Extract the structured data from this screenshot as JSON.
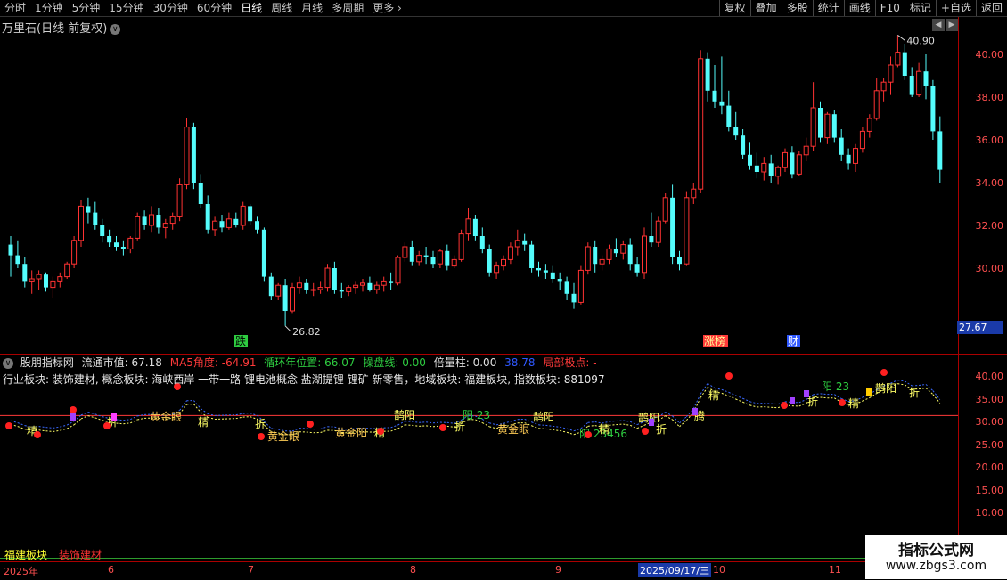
{
  "toolbar": {
    "timeframes": [
      "分时",
      "1分钟",
      "5分钟",
      "15分钟",
      "30分钟",
      "60分钟",
      "日线",
      "周线",
      "月线",
      "多周期",
      "更多"
    ],
    "active": "日线",
    "right_buttons": [
      "复权",
      "叠加",
      "多股",
      "统计",
      "画线",
      "F10",
      "标记",
      "+自选",
      "返回"
    ]
  },
  "stock": {
    "title": "万里石(日线 前复权)"
  },
  "price_axis": {
    "ticks": [
      "40.00",
      "38.00",
      "36.00",
      "34.00",
      "32.00",
      "30.00"
    ],
    "current_price": "27.67"
  },
  "annotations": {
    "high": "40.90",
    "low": "26.82",
    "marker_die": "跌",
    "marker_zhangbang": "涨榜",
    "marker_cai": "财"
  },
  "indicator": {
    "name": "股朋指标网",
    "float_mv": "流通市值: 67.18",
    "ma5_angle": "MA5角度: -64.91",
    "cycle_pos": "循环年位置: 66.07",
    "op_line": "操盘线: 0.00",
    "bei_li": "倍量柱: 0.00",
    "num": "38.78",
    "local_pt": "局部极点: -",
    "sectors": "行业板块: 装饰建材, 概念板块: 海峡西岸 一带一路 锂电池概念 盐湖提锂 锂矿 新零售，地域板块: 福建板块, 指数板块: 881097",
    "axis_ticks": [
      "40.00",
      "35.00",
      "30.00",
      "25.00",
      "20.00",
      "15.00",
      "10.00"
    ]
  },
  "signals": [
    "精",
    "折",
    "黄金眼",
    "精",
    "折",
    "黄金眼",
    "黄金阳",
    "精",
    "鹊阳",
    "阳 23",
    "折",
    "黄金眼",
    "鹊阳",
    "阳 23456",
    "精",
    "鹊阳",
    "折",
    "腾",
    "精",
    "阳 23",
    "折",
    "精",
    "鹊阳",
    "折"
  ],
  "bottom_labels": {
    "label1": "福建板块",
    "label2": "装饰建材"
  },
  "date_axis": {
    "labels": [
      "2025年",
      "6",
      "7",
      "8",
      "9",
      "10",
      "11"
    ],
    "highlight": "2025/09/17/三"
  },
  "watermark": {
    "title": "指标公式网",
    "url": "www.zbgs3.com"
  },
  "colors": {
    "up": "#ff3232",
    "down": "#54fcfc",
    "axis": "#a00000"
  },
  "candles": [
    [
      31.1,
      31.5,
      29.6,
      30.6
    ],
    [
      30.6,
      31.3,
      30.0,
      30.2
    ],
    [
      30.2,
      30.5,
      29.1,
      29.4
    ],
    [
      29.4,
      29.9,
      28.8,
      29.5
    ],
    [
      29.5,
      29.9,
      29.0,
      29.7
    ],
    [
      29.7,
      29.8,
      28.9,
      29.1
    ],
    [
      29.1,
      29.6,
      28.6,
      29.4
    ],
    [
      29.4,
      29.8,
      29.1,
      29.6
    ],
    [
      29.6,
      30.3,
      29.5,
      30.2
    ],
    [
      30.2,
      31.5,
      30.0,
      31.3
    ],
    [
      31.3,
      33.2,
      31.0,
      32.9
    ],
    [
      32.9,
      33.3,
      32.1,
      32.6
    ],
    [
      32.6,
      33.1,
      31.8,
      32.0
    ],
    [
      32.0,
      32.3,
      31.2,
      31.5
    ],
    [
      31.5,
      31.8,
      31.0,
      31.2
    ],
    [
      31.2,
      31.5,
      30.8,
      31.0
    ],
    [
      31.0,
      31.3,
      30.6,
      30.9
    ],
    [
      30.9,
      31.5,
      30.7,
      31.4
    ],
    [
      31.4,
      32.6,
      31.3,
      32.4
    ],
    [
      32.4,
      32.7,
      31.8,
      32.0
    ],
    [
      32.0,
      32.9,
      31.7,
      32.5
    ],
    [
      32.5,
      32.8,
      31.6,
      31.9
    ],
    [
      31.9,
      32.3,
      31.4,
      32.1
    ],
    [
      32.1,
      32.6,
      31.8,
      32.4
    ],
    [
      32.4,
      34.2,
      32.2,
      33.9
    ],
    [
      33.9,
      37.0,
      33.7,
      36.6
    ],
    [
      36.6,
      36.8,
      33.7,
      34.0
    ],
    [
      34.0,
      34.4,
      32.8,
      33.0
    ],
    [
      33.0,
      33.4,
      31.6,
      31.8
    ],
    [
      31.8,
      32.4,
      31.5,
      32.2
    ],
    [
      32.2,
      32.5,
      31.7,
      31.9
    ],
    [
      31.9,
      32.6,
      31.8,
      32.3
    ],
    [
      32.3,
      32.6,
      31.9,
      32.0
    ],
    [
      32.0,
      33.1,
      31.8,
      32.9
    ],
    [
      32.9,
      33.0,
      32.0,
      32.2
    ],
    [
      32.2,
      32.4,
      31.6,
      31.8
    ],
    [
      31.8,
      31.9,
      29.4,
      29.6
    ],
    [
      29.6,
      29.8,
      28.5,
      28.7
    ],
    [
      28.7,
      29.3,
      28.5,
      29.2
    ],
    [
      29.2,
      29.5,
      27.3,
      28.0
    ],
    [
      28.0,
      29.3,
      27.9,
      29.1
    ],
    [
      29.1,
      29.6,
      28.8,
      29.3
    ],
    [
      29.3,
      29.5,
      28.8,
      29.0
    ],
    [
      29.0,
      29.3,
      28.7,
      29.0
    ],
    [
      29.0,
      29.4,
      28.8,
      29.1
    ],
    [
      29.1,
      30.2,
      28.9,
      30.0
    ],
    [
      30.0,
      30.3,
      28.8,
      29.0
    ],
    [
      29.0,
      29.3,
      28.6,
      28.9
    ],
    [
      28.9,
      29.2,
      28.7,
      29.1
    ],
    [
      29.1,
      29.4,
      28.8,
      29.2
    ],
    [
      29.2,
      29.5,
      28.9,
      29.3
    ],
    [
      29.3,
      29.6,
      28.9,
      29.0
    ],
    [
      29.0,
      29.4,
      28.8,
      29.2
    ],
    [
      29.2,
      29.6,
      28.9,
      29.4
    ],
    [
      29.4,
      29.8,
      29.0,
      29.3
    ],
    [
      29.3,
      30.6,
      29.2,
      30.5
    ],
    [
      30.5,
      31.2,
      30.3,
      31.0
    ],
    [
      31.0,
      31.3,
      30.1,
      30.3
    ],
    [
      30.3,
      30.8,
      30.1,
      30.6
    ],
    [
      30.6,
      31.0,
      30.2,
      30.5
    ],
    [
      30.5,
      30.8,
      30.0,
      30.2
    ],
    [
      30.2,
      30.9,
      30.0,
      30.8
    ],
    [
      30.8,
      31.1,
      29.9,
      30.1
    ],
    [
      30.1,
      30.6,
      30.0,
      30.4
    ],
    [
      30.4,
      31.8,
      30.3,
      31.6
    ],
    [
      31.6,
      32.8,
      31.3,
      32.3
    ],
    [
      32.3,
      32.5,
      31.3,
      31.5
    ],
    [
      31.5,
      31.9,
      30.7,
      30.9
    ],
    [
      30.9,
      31.1,
      29.6,
      29.8
    ],
    [
      29.8,
      30.3,
      29.5,
      30.1
    ],
    [
      30.1,
      30.6,
      29.9,
      30.4
    ],
    [
      30.4,
      31.2,
      30.2,
      31.0
    ],
    [
      31.0,
      31.8,
      30.6,
      31.3
    ],
    [
      31.3,
      31.6,
      30.8,
      31.1
    ],
    [
      31.1,
      31.3,
      29.8,
      30.0
    ],
    [
      30.0,
      30.3,
      29.6,
      29.9
    ],
    [
      29.9,
      30.2,
      29.5,
      29.8
    ],
    [
      29.8,
      30.1,
      29.3,
      29.5
    ],
    [
      29.5,
      29.8,
      29.0,
      29.4
    ],
    [
      29.4,
      29.6,
      28.5,
      28.8
    ],
    [
      28.8,
      29.3,
      28.1,
      28.4
    ],
    [
      28.4,
      30.1,
      28.3,
      29.9
    ],
    [
      29.9,
      31.2,
      29.7,
      31.0
    ],
    [
      31.0,
      31.3,
      29.8,
      30.2
    ],
    [
      30.2,
      30.6,
      29.9,
      30.4
    ],
    [
      30.4,
      31.1,
      30.2,
      30.9
    ],
    [
      30.9,
      31.4,
      30.5,
      30.7
    ],
    [
      30.7,
      31.3,
      30.4,
      31.1
    ],
    [
      31.1,
      31.4,
      29.9,
      30.2
    ],
    [
      30.2,
      30.5,
      29.6,
      29.8
    ],
    [
      29.8,
      31.9,
      29.5,
      31.5
    ],
    [
      31.5,
      32.6,
      31.0,
      31.2
    ],
    [
      31.2,
      32.4,
      31.0,
      32.2
    ],
    [
      32.2,
      33.5,
      32.1,
      33.3
    ],
    [
      33.3,
      33.9,
      30.2,
      30.5
    ],
    [
      30.5,
      30.8,
      29.9,
      30.2
    ],
    [
      30.2,
      33.6,
      30.1,
      33.3
    ],
    [
      33.3,
      34.0,
      33.0,
      33.7
    ],
    [
      33.7,
      40.2,
      33.5,
      39.8
    ],
    [
      39.8,
      40.1,
      37.8,
      38.3
    ],
    [
      38.3,
      39.5,
      37.5,
      37.8
    ],
    [
      37.8,
      39.9,
      37.2,
      37.6
    ],
    [
      37.6,
      38.3,
      36.4,
      36.6
    ],
    [
      36.6,
      37.3,
      36.0,
      36.2
    ],
    [
      36.2,
      36.5,
      35.1,
      35.3
    ],
    [
      35.3,
      35.9,
      34.6,
      34.8
    ],
    [
      34.8,
      35.4,
      34.2,
      34.5
    ],
    [
      34.5,
      35.2,
      34.1,
      34.9
    ],
    [
      34.9,
      35.3,
      34.0,
      34.3
    ],
    [
      34.3,
      34.8,
      33.9,
      34.7
    ],
    [
      34.7,
      35.6,
      34.5,
      35.4
    ],
    [
      35.4,
      35.7,
      34.2,
      34.4
    ],
    [
      34.4,
      35.5,
      34.3,
      35.3
    ],
    [
      35.3,
      36.1,
      35.0,
      35.7
    ],
    [
      35.7,
      38.7,
      35.5,
      37.5
    ],
    [
      37.5,
      37.8,
      35.9,
      36.1
    ],
    [
      36.1,
      37.3,
      35.8,
      37.2
    ],
    [
      37.2,
      37.4,
      35.9,
      36.1
    ],
    [
      36.1,
      36.5,
      35.0,
      35.3
    ],
    [
      35.3,
      35.6,
      34.6,
      34.9
    ],
    [
      34.9,
      35.8,
      34.5,
      35.6
    ],
    [
      35.6,
      36.6,
      35.4,
      36.4
    ],
    [
      36.4,
      37.2,
      36.1,
      37.0
    ],
    [
      37.0,
      38.9,
      36.9,
      38.3
    ],
    [
      38.3,
      38.9,
      37.8,
      38.7
    ],
    [
      38.7,
      39.9,
      38.1,
      39.5
    ],
    [
      39.5,
      40.9,
      39.4,
      40.1
    ],
    [
      40.1,
      40.5,
      38.8,
      39.0
    ],
    [
      39.0,
      39.4,
      38.0,
      38.1
    ],
    [
      38.1,
      39.6,
      38.0,
      39.2
    ],
    [
      39.2,
      40.0,
      37.9,
      38.5
    ],
    [
      38.5,
      38.8,
      36.0,
      36.4
    ],
    [
      36.4,
      37.1,
      34.0,
      34.6
    ]
  ]
}
